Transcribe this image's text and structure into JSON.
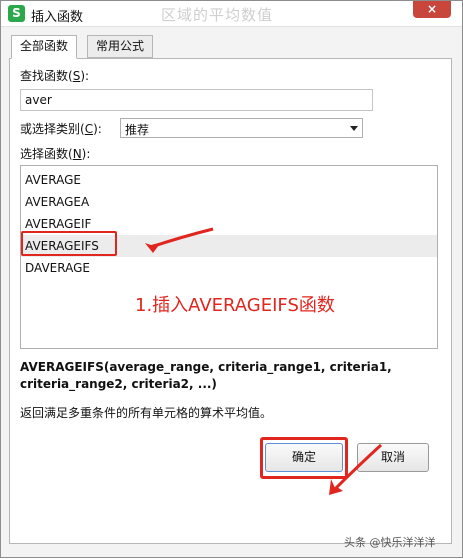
{
  "window": {
    "title": "插入函数",
    "app_icon": "S",
    "ghost_title": "区域的平均数值",
    "close_icon": "×"
  },
  "tabs": [
    {
      "label": "全部函数",
      "active": true
    },
    {
      "label": "常用公式",
      "active": false
    }
  ],
  "search": {
    "label": "查找函数(",
    "shortcut": "S",
    "label_end": "):",
    "value": "aver"
  },
  "category": {
    "label": "或选择类别(",
    "shortcut": "C",
    "label_end": "):",
    "selected": "推荐"
  },
  "function_list": {
    "label": "选择函数(",
    "shortcut": "N",
    "label_end": "):",
    "items": [
      "AVERAGE",
      "AVERAGEA",
      "AVERAGEIF",
      "AVERAGEIFS",
      "DAVERAGE"
    ],
    "selected_index": 3
  },
  "annotation": "1.插入AVERAGEIFS函数",
  "syntax": "AVERAGEIFS(average_range, criteria_range1, criteria1, criteria_range2, criteria2, ...)",
  "description": "返回满足多重条件的所有单元格的算术平均值。",
  "buttons": {
    "ok": "确定",
    "cancel": "取消"
  },
  "watermark": "头条 @快乐洋洋洋",
  "colors": {
    "annotation_red": "#e0261e",
    "app_icon_green": "#2aa84b",
    "close_red": "#c9463d"
  }
}
